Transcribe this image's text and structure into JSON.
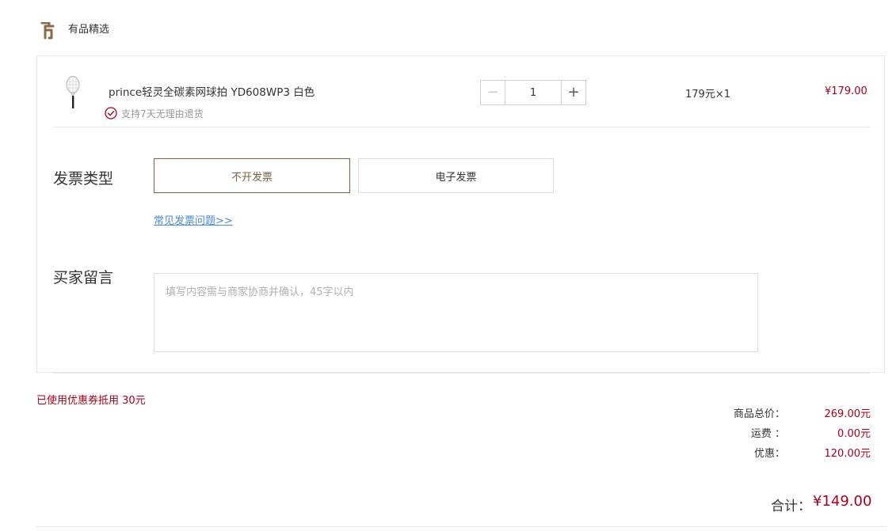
{
  "store": {
    "name": "有品精选",
    "logo_icon": "youpin-logo-icon",
    "logo_color": "#8b6a47"
  },
  "product": {
    "name": "prince轻灵全碳素网球拍 YD608WP3 白色",
    "image_icon": "tennis-racket-icon",
    "return_policy": "支持7天无理由退货",
    "return_icon": "check-circle-icon",
    "quantity": "1",
    "unit_price_qty": "179元×1",
    "line_total": "¥179.00"
  },
  "invoice": {
    "label": "发票类型",
    "options": [
      "不开发票",
      "电子发票"
    ],
    "selected": "不开发票",
    "faq_link": "常见发票问题>>"
  },
  "message": {
    "label": "买家留言",
    "placeholder": "填写内容需与商家协商并确认，45字以内",
    "value": ""
  },
  "coupon_note": "已使用优惠券抵用 30元",
  "summary": {
    "rows": [
      {
        "label": "商品总价：",
        "value": "269.00元"
      },
      {
        "label": "运费 ：",
        "value": "0.00元"
      },
      {
        "label": "优惠：",
        "value": "120.00元"
      }
    ],
    "total_label": "合计：",
    "total_value": "¥149.00"
  },
  "colors": {
    "accent": "#a8001c",
    "brand": "#7a6148",
    "link": "#4a8bd6",
    "border": "#e6e6e6"
  }
}
